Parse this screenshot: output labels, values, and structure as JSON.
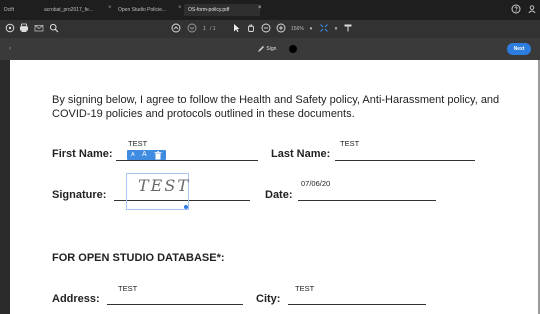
{
  "tabs": [
    {
      "label": "Dcift"
    },
    {
      "label": "acrobat_pro2017_fe..."
    },
    {
      "label": "Open Studio Policie..."
    },
    {
      "label": "OS-form-policy.pdf"
    }
  ],
  "toolbar": {
    "page_current": "1",
    "page_total": "/ 1",
    "zoom": "156%"
  },
  "signbar": {
    "sign_label": "Sign",
    "next_label": "Next"
  },
  "document": {
    "agreement_text": "By signing below, I agree to follow the Health and Safety policy, Anti-Harassment policy, and COVID-19 policies and protocols outlined in these documents.",
    "first_name_label": "First Name:",
    "first_name_value": "TEST",
    "last_name_label": "Last Name:",
    "last_name_value": "TEST",
    "signature_label": "Signature:",
    "signature_value": "TEST",
    "date_label": "Date:",
    "date_value": "07/06/20",
    "database_heading": "FOR OPEN STUDIO DATABASE*:",
    "address_label": "Address:",
    "address_value": "TEST",
    "city_label": "City:",
    "city_value": "TEST"
  },
  "text_tools": {
    "small_a": "A",
    "large_a": "A",
    "delete_icon": "trash-icon"
  },
  "colors": {
    "accent": "#2d7de0",
    "toolbar_bg": "#323232",
    "page_bg": "#ffffff"
  }
}
